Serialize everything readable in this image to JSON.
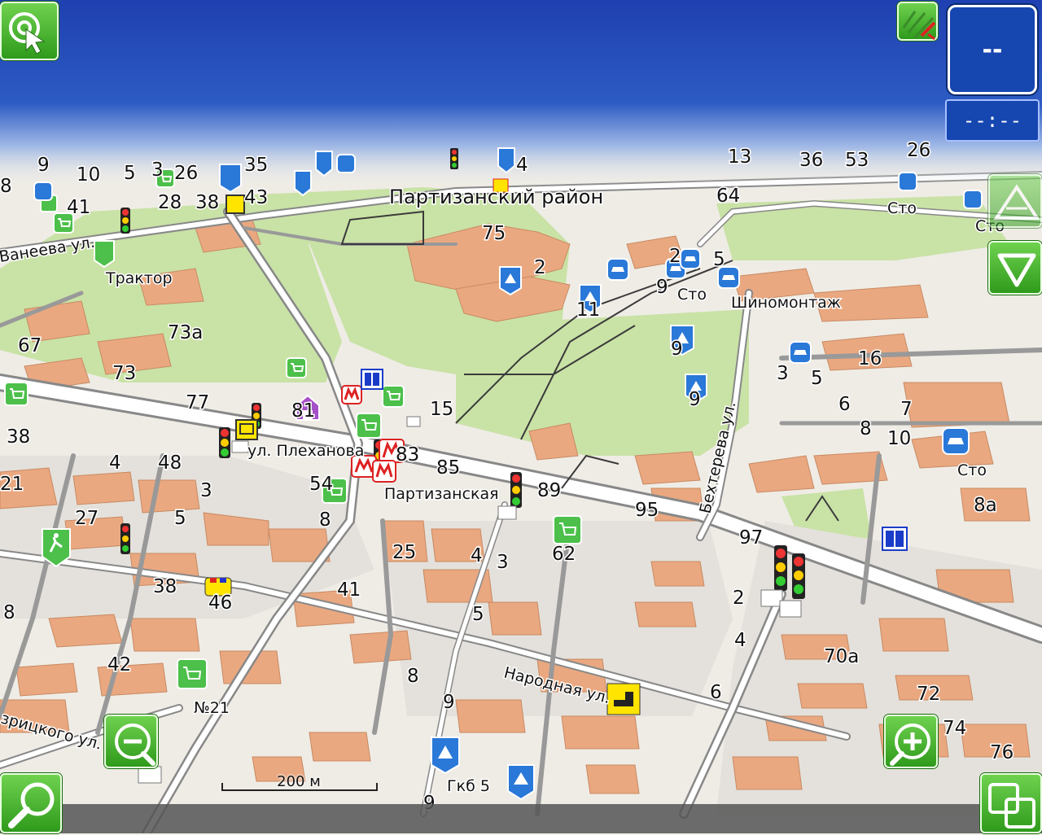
{
  "top_bar": {
    "speed_value": "--",
    "time_value": "--:--"
  },
  "scale": {
    "label": "200 м"
  },
  "map": {
    "district": "Партизанский район",
    "streets": {
      "vaneeva": "Ванеева ул.",
      "plekhanova": "ул. Плеханова",
      "bekhtereva": "Бехтерева ул.",
      "narodnaya": "Народная ул.",
      "dzeritskogo": "зрицкого ул."
    },
    "places": {
      "traktor": "Трактор",
      "partizanskaya": "Партизанская",
      "shinomontazh": "Шиномонтаж",
      "sto1": "Сто",
      "sto2": "Сто",
      "sto3": "Сто",
      "sto4": "Сто",
      "gkb5": "Гкб 5",
      "n21": "№21"
    },
    "house_numbers": {
      "h35": "35",
      "h4a": "4",
      "h13": "13",
      "h36": "36",
      "h53": "53",
      "h26": "26",
      "h9a": "9",
      "h10a": "10",
      "h5a": "5",
      "h3a": "3",
      "h26b": "26",
      "h8a": "8",
      "h41a": "41",
      "h28": "28",
      "h38a": "38",
      "h43": "43",
      "h64": "64",
      "h75": "75",
      "h2a": "2",
      "h2b": "2",
      "h5b": "5",
      "h9b": "9",
      "h11": "11",
      "h67": "67",
      "h73a": "73а",
      "h73": "73",
      "h77": "77",
      "h81": "81",
      "h15": "15",
      "h3b": "3",
      "h5c": "5",
      "h16": "16",
      "h9c": "9",
      "h9d": "9",
      "h6a": "6",
      "h7": "7",
      "h8b": "8",
      "h10b": "10",
      "h38b": "38",
      "h48": "48",
      "h4b": "4",
      "h21": "21",
      "h3c": "3",
      "h83": "83",
      "h85": "85",
      "h54": "54",
      "h89": "89",
      "h95": "95",
      "h8c": "8",
      "h27": "27",
      "h5d": "5",
      "h8a2": "8а",
      "h97": "97",
      "h25": "25",
      "h4c": "4",
      "h3d": "3",
      "h62": "62",
      "h38c": "38",
      "h46": "46",
      "h41b": "41",
      "h8d": "8",
      "h5e": "5",
      "h2c": "2",
      "h4d": "4",
      "h70a": "70а",
      "h42": "42",
      "h8e": "8",
      "h9e": "9",
      "h6b": "6",
      "h72": "72",
      "h74": "74",
      "h76": "76",
      "h9f": "9"
    }
  }
}
